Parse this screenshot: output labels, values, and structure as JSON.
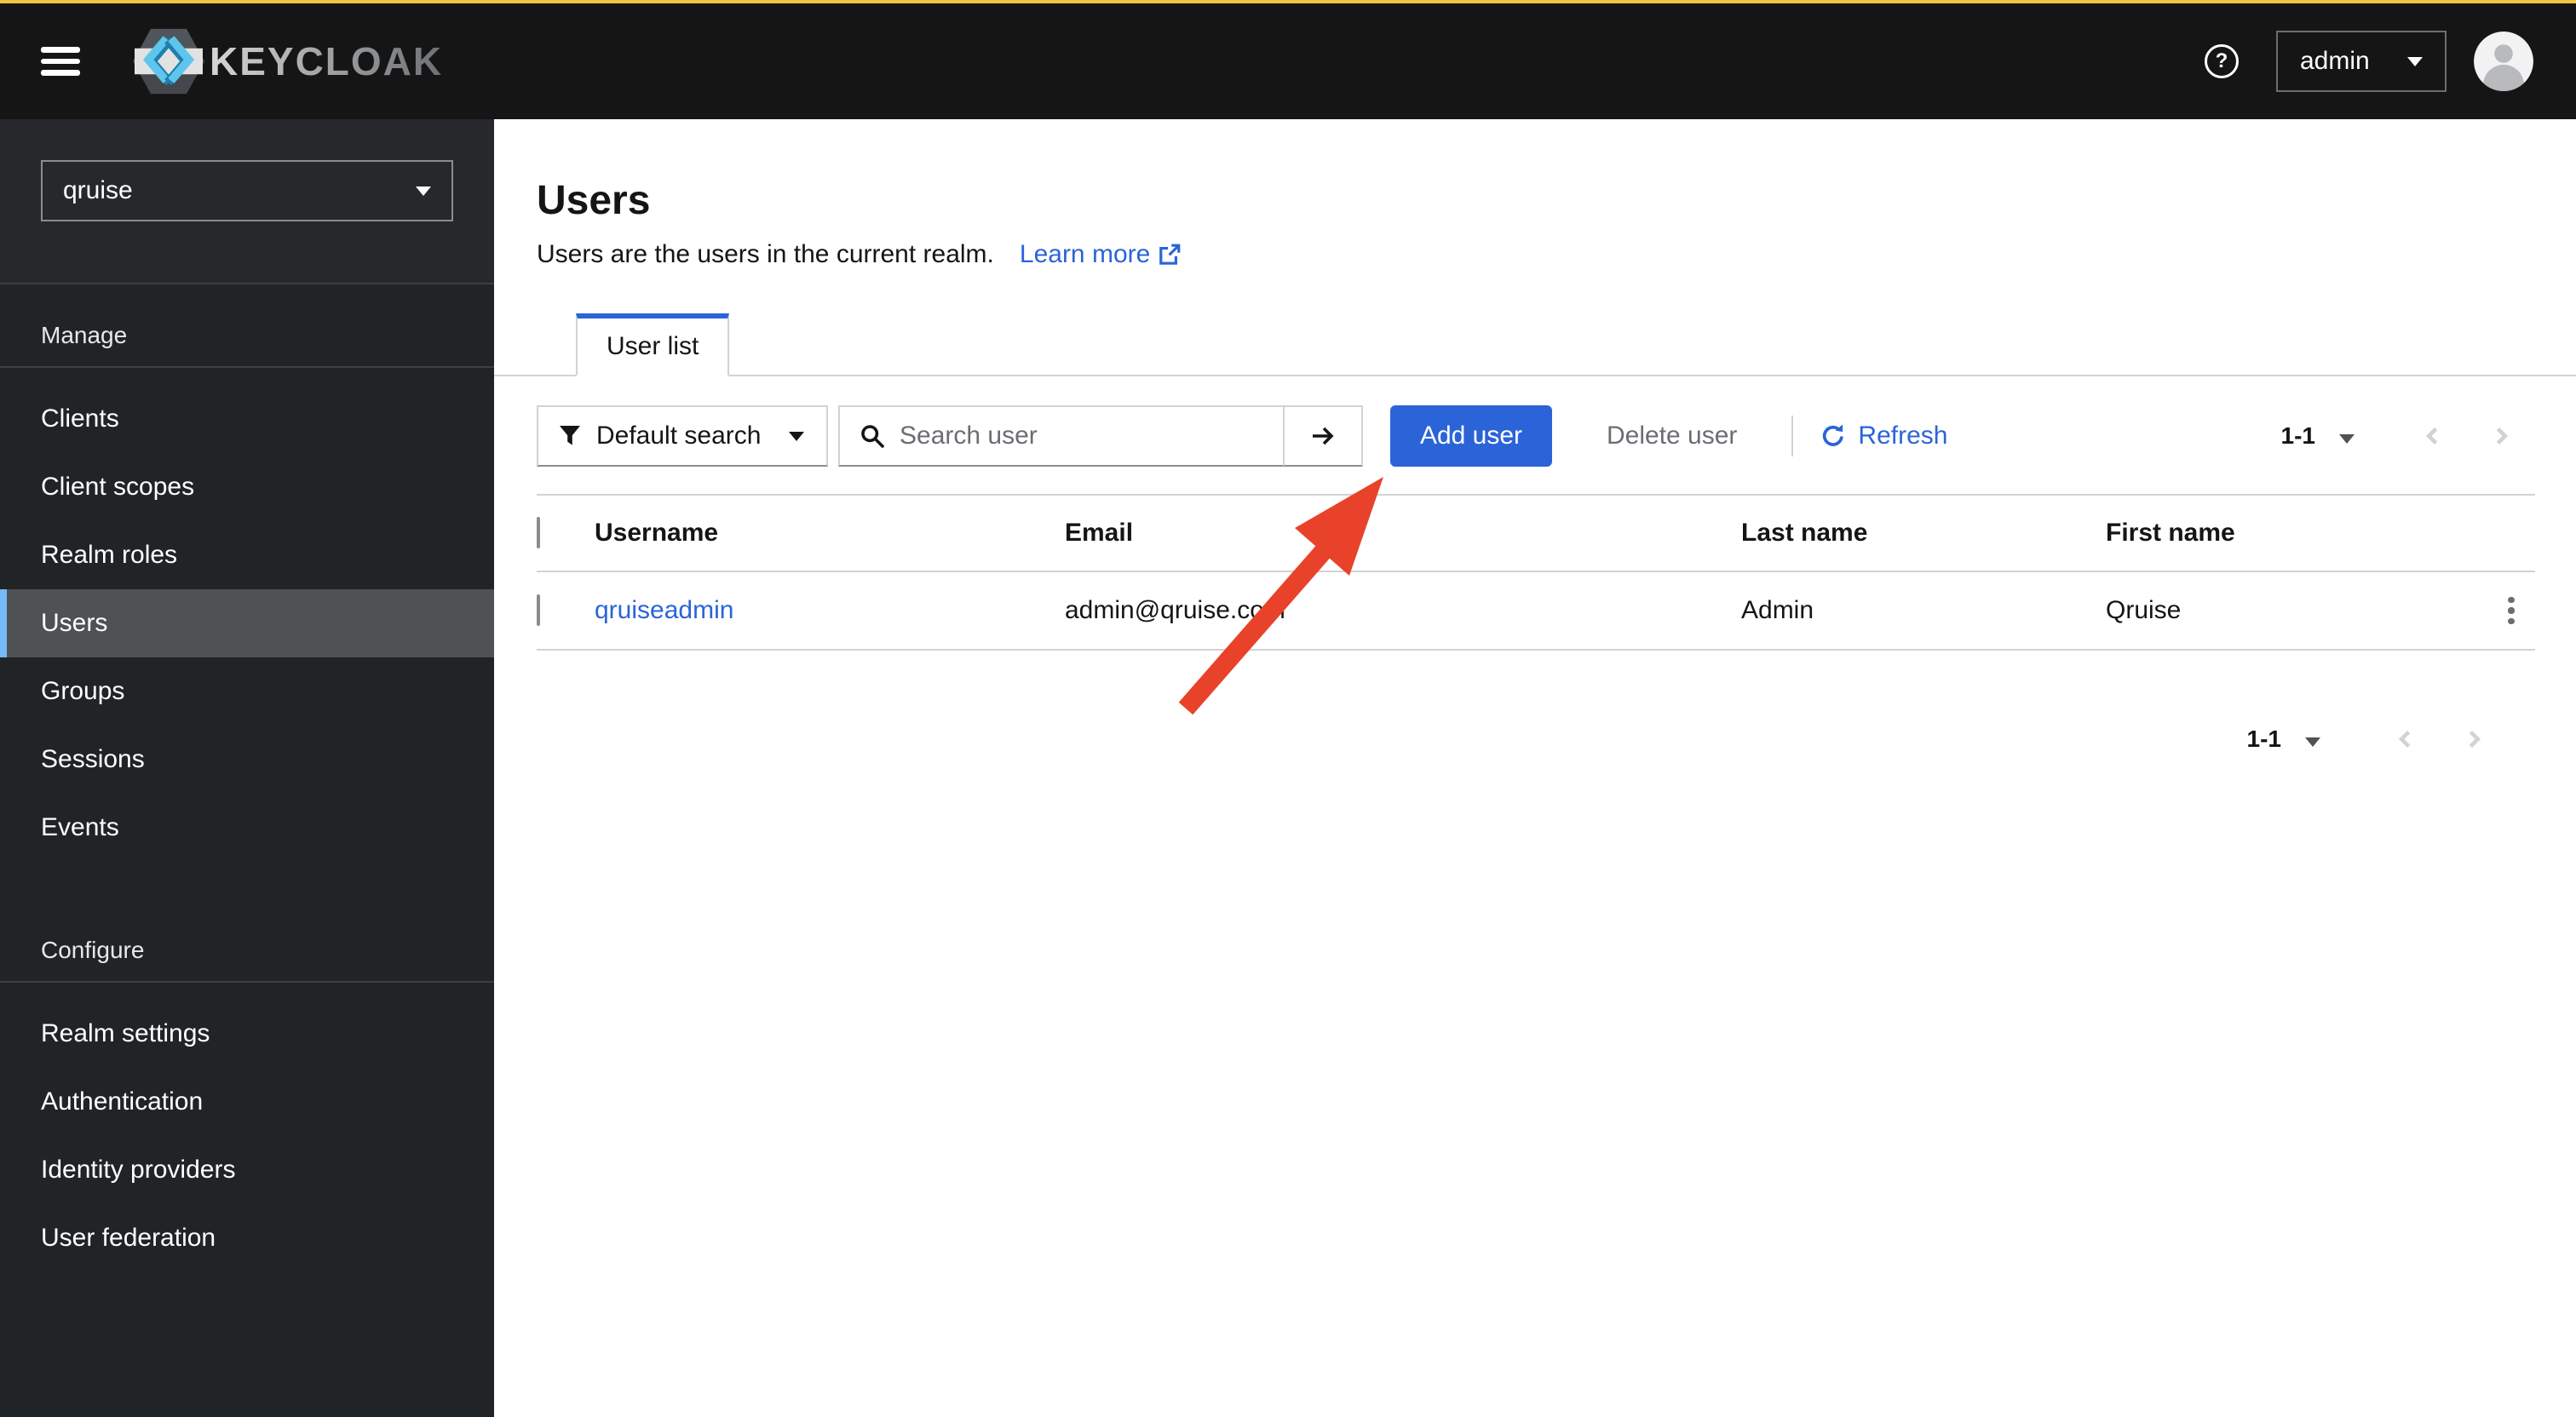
{
  "masthead": {
    "brand": "KEYCLOAK",
    "help_glyph": "?",
    "username": "admin"
  },
  "sidebar": {
    "realm": "qruise",
    "sections": [
      {
        "label": "Manage",
        "items": [
          "Clients",
          "Client scopes",
          "Realm roles",
          "Users",
          "Groups",
          "Sessions",
          "Events"
        ]
      },
      {
        "label": "Configure",
        "items": [
          "Realm settings",
          "Authentication",
          "Identity providers",
          "User federation"
        ]
      }
    ],
    "active_item": "Users"
  },
  "page": {
    "title": "Users",
    "description": "Users are the users in the current realm.",
    "learn_more_label": "Learn more"
  },
  "tabs": [
    {
      "label": "User list",
      "active": true
    }
  ],
  "toolbar": {
    "filter_label": "Default search",
    "search_placeholder": "Search user",
    "add_user_label": "Add user",
    "delete_user_label": "Delete user",
    "refresh_label": "Refresh"
  },
  "pagination": {
    "top_range": "1-1",
    "bottom_range": "1-1"
  },
  "table": {
    "headers": [
      "Username",
      "Email",
      "Last name",
      "First name"
    ],
    "rows": [
      {
        "username": "qruiseadmin",
        "email": "admin@qruise.com",
        "last_name": "Admin",
        "first_name": "Qruise"
      }
    ]
  },
  "colors": {
    "accent": "#2b64d8",
    "arrow": "#e8432a",
    "indicator": "#73bcf7",
    "strip": "#f0c43e"
  }
}
